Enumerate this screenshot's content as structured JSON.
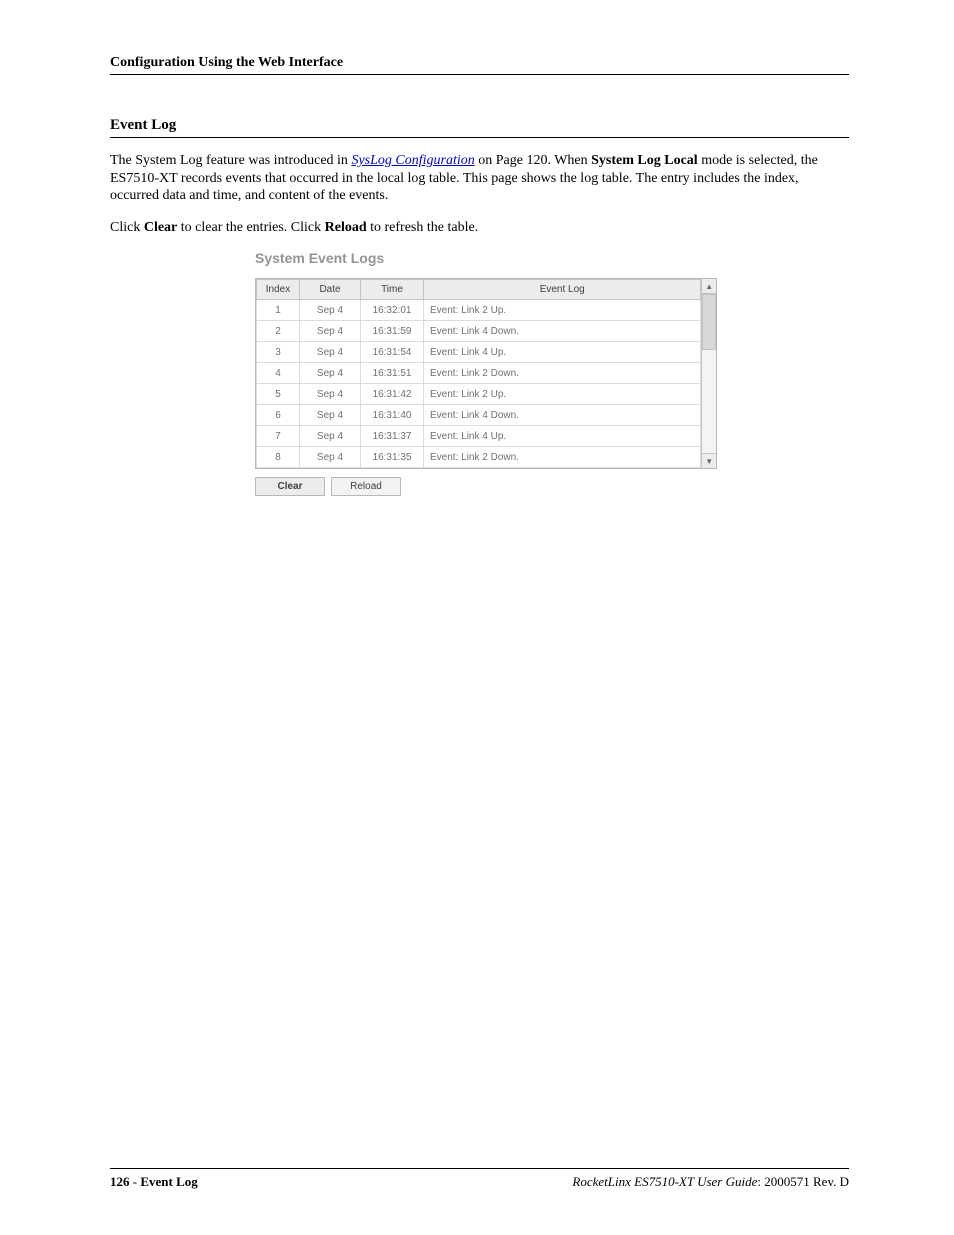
{
  "header": {
    "running": "Configuration Using the Web Interface"
  },
  "section": {
    "title": "Event Log"
  },
  "para1": {
    "t1": "The System Log feature was introduced in ",
    "link": "SysLog Configuration",
    "t2": " on Page 120. When ",
    "bold1": "System Log Local",
    "t3": " mode is selected, the ES7510-XT records events that occurred in the local log table. This page shows the log table. The entry includes the index, occurred data and time, and content of the events."
  },
  "para2": {
    "t1": "Click ",
    "bold1": "Clear",
    "t2": " to clear the entries. Click ",
    "bold2": "Reload",
    "t3": " to refresh the table."
  },
  "embed": {
    "title": "System Event Logs",
    "columns": {
      "c1": "Index",
      "c2": "Date",
      "c3": "Time",
      "c4": "Event Log"
    },
    "rows": [
      {
        "idx": "1",
        "date": "Sep 4",
        "time": "16:32:01",
        "msg": "Event: Link 2 Up."
      },
      {
        "idx": "2",
        "date": "Sep 4",
        "time": "16:31:59",
        "msg": "Event: Link 4 Down."
      },
      {
        "idx": "3",
        "date": "Sep 4",
        "time": "16:31:54",
        "msg": "Event: Link 4 Up."
      },
      {
        "idx": "4",
        "date": "Sep 4",
        "time": "16:31:51",
        "msg": "Event: Link 2 Down."
      },
      {
        "idx": "5",
        "date": "Sep 4",
        "time": "16:31:42",
        "msg": "Event: Link 2 Up."
      },
      {
        "idx": "6",
        "date": "Sep 4",
        "time": "16:31:40",
        "msg": "Event: Link 4 Down."
      },
      {
        "idx": "7",
        "date": "Sep 4",
        "time": "16:31:37",
        "msg": "Event: Link 4 Up."
      },
      {
        "idx": "8",
        "date": "Sep 4",
        "time": "16:31:35",
        "msg": "Event: Link 2 Down."
      }
    ],
    "buttons": {
      "clear": "Clear",
      "reload": "Reload"
    }
  },
  "footer": {
    "page_num": "126",
    "sep": " - ",
    "page_name": "Event Log",
    "product": "RocketLinx ES7510-XT  User Guide",
    "rev": ": 2000571 Rev. D"
  }
}
